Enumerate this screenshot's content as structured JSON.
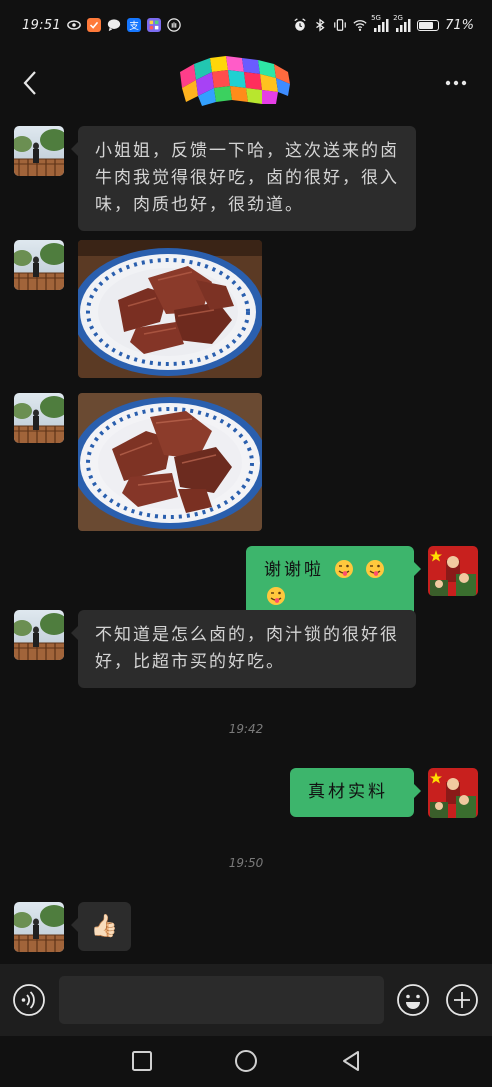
{
  "status_bar": {
    "time": "19:51",
    "net1": "5G",
    "net2": "2G",
    "battery": "71%"
  },
  "header": {
    "title_obscured": true
  },
  "messages": [
    {
      "side": "left",
      "type": "text",
      "text": "小姐姐，反馈一下哈，这次送来的卤牛肉我觉得很好吃，卤的很好，很入味，肉质也好，很劲道。"
    },
    {
      "side": "left",
      "type": "image",
      "alt": "photo-braised-beef-1"
    },
    {
      "side": "left",
      "type": "image",
      "alt": "photo-braised-beef-2"
    },
    {
      "side": "right",
      "type": "text",
      "text": "谢谢啦",
      "emojis": [
        "wink-tongue-emoji",
        "wink-tongue-emoji",
        "wink-tongue-emoji"
      ]
    },
    {
      "side": "left",
      "type": "text",
      "text": "不知道是怎么卤的，肉汁锁的很好很好，比超市买的好吃。"
    },
    {
      "type": "timestamp",
      "text": "19:42"
    },
    {
      "side": "right",
      "type": "text",
      "text": "真材实料"
    },
    {
      "type": "timestamp",
      "text": "19:50"
    },
    {
      "side": "left",
      "type": "emoji",
      "text": "👍🏻"
    }
  ],
  "input_bar": {
    "value": "",
    "placeholder": ""
  },
  "colors": {
    "background": "#111111",
    "bubble_left": "#2c2c2c",
    "bubble_right": "#3db56c",
    "timestamp": "#7a7a7a"
  },
  "icons": [
    "back-arrow-icon",
    "more-icon",
    "voice-icon",
    "emoji-icon",
    "plus-icon",
    "nav-square-icon",
    "nav-circle-icon",
    "nav-back-icon"
  ]
}
